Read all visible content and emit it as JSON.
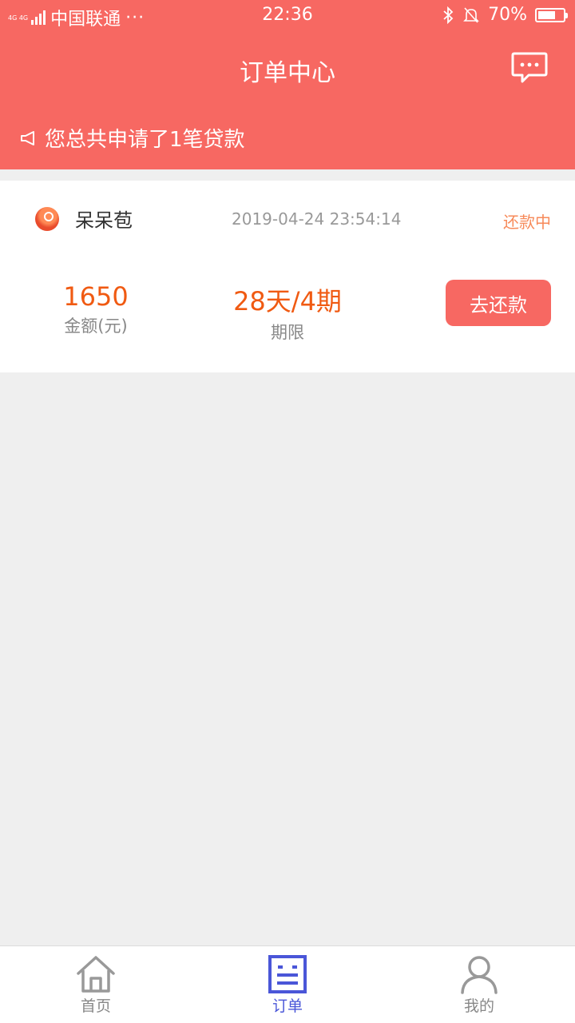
{
  "status_bar": {
    "network_top": "4G 4G",
    "carrier": "中国联通",
    "more": "···",
    "time": "22:36",
    "battery_text": "70%",
    "battery_level": 0.7,
    "icons": [
      "bluetooth-icon",
      "bell-muted-icon",
      "battery-icon"
    ]
  },
  "header": {
    "title": "订单中心",
    "message_icon": "chat-bubble-icon",
    "notice_icon": "megaphone-icon",
    "notice_text": "您总共申请了1笔贷款"
  },
  "order": {
    "product_name": "呆呆苞",
    "time": "2019-04-24 23:54:14",
    "status": "还款中",
    "amount_value": "1650",
    "amount_label": "金额(元)",
    "term_value": "28天/4期",
    "term_label": "期限",
    "action_label": "去还款"
  },
  "tabbar": {
    "items": [
      {
        "label": "首页",
        "icon": "home-icon",
        "active": false
      },
      {
        "label": "订单",
        "icon": "order-list-icon",
        "active": true
      },
      {
        "label": "我的",
        "icon": "user-icon",
        "active": false
      }
    ]
  },
  "colors": {
    "brand": "#f76862",
    "accent_value": "#f05a12",
    "status": "#f78a5a",
    "tab_active": "#4a56d8",
    "tab_inactive": "#888888",
    "background": "#efefef"
  }
}
